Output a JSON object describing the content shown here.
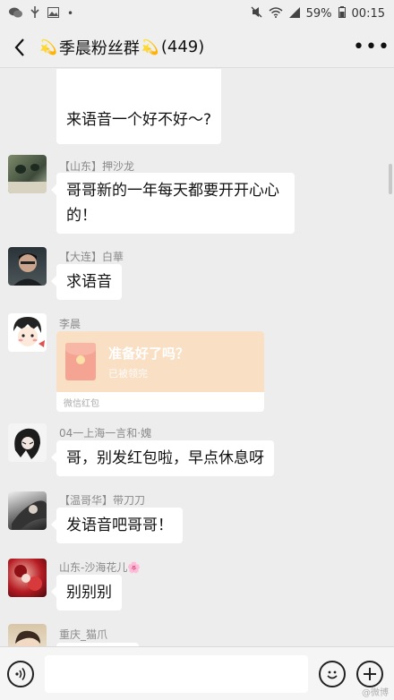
{
  "status_bar": {
    "battery": "59%",
    "time": "00:15"
  },
  "header": {
    "title": "季晨粉丝群",
    "member_count": "(449)"
  },
  "messages": [
    {
      "text": "来语音一个好不好～?"
    },
    {
      "sender": "【山东】押沙龙",
      "text": "哥哥新的一年每天都要开开心心的！"
    },
    {
      "sender": "【大连】白華",
      "text": "求语音"
    },
    {
      "sender": "李晨",
      "red_packet": {
        "title": "准备好了吗？",
        "status": "已被领完",
        "footer": "微信红包"
      }
    },
    {
      "sender": "04一上海一言和·媿",
      "text": "哥，别发红包啦，早点休息呀"
    },
    {
      "sender": "【温哥华】带刀刀",
      "text": "发语音吧哥哥！"
    },
    {
      "sender": "山东-沙海花儿",
      "text": "别别别"
    },
    {
      "sender": "重庆_猫爪"
    }
  ],
  "input_bar": {
    "value": ""
  },
  "watermark": "@微博"
}
